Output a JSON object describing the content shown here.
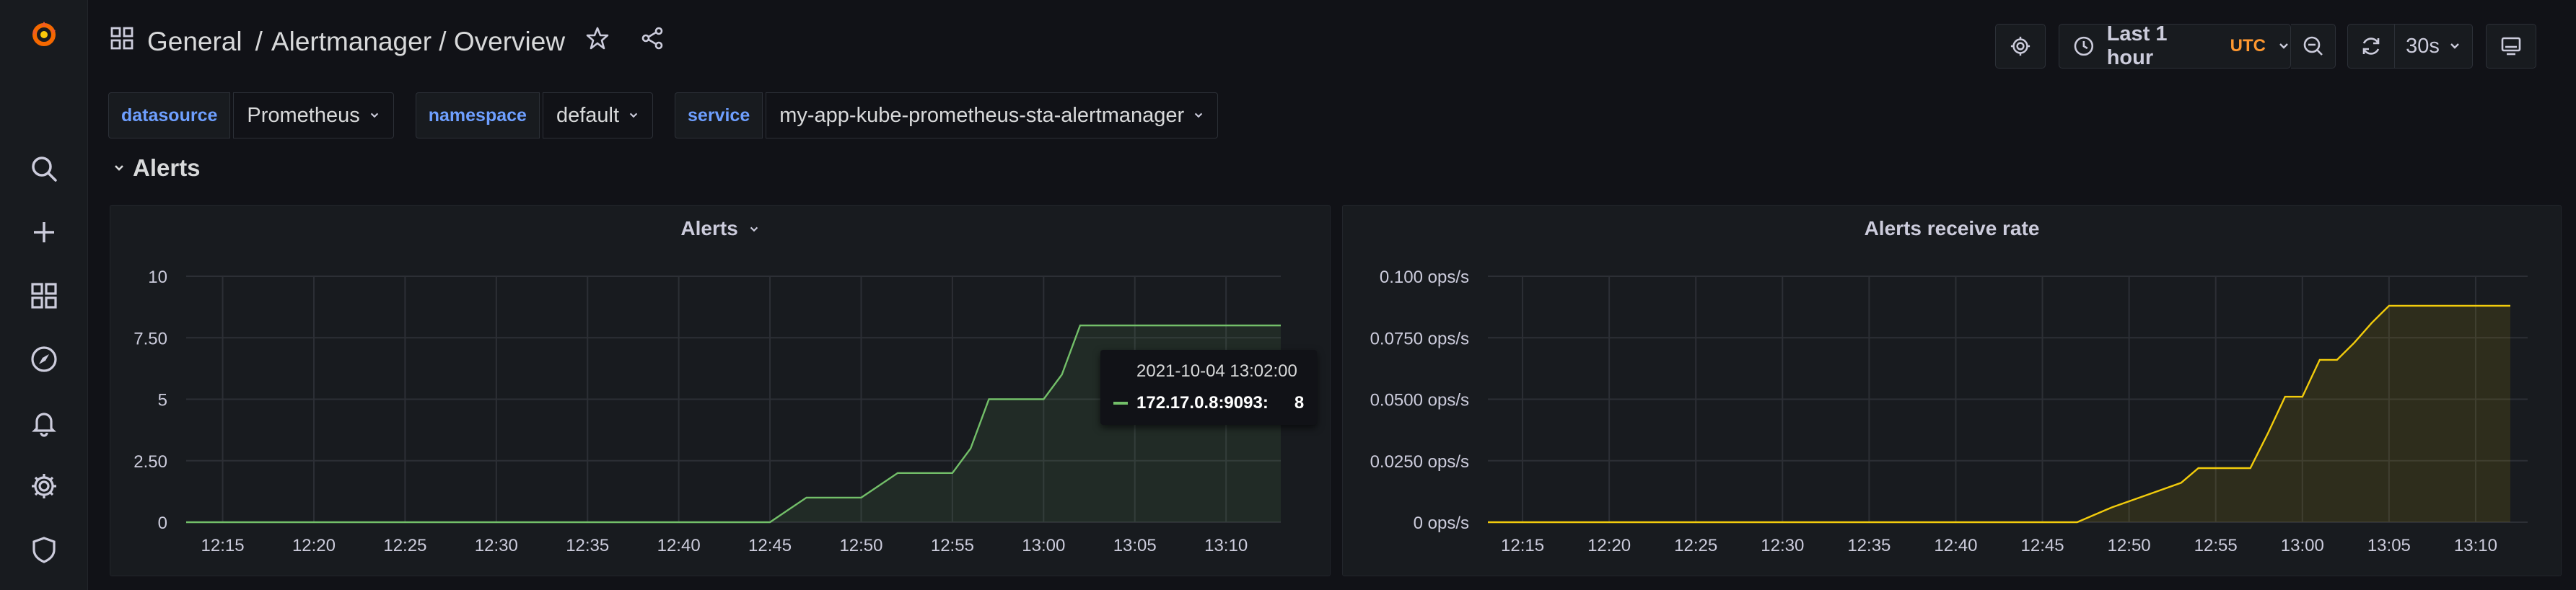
{
  "breadcrumb": {
    "folder": "General",
    "sep": "/",
    "path": "Alertmanager / Overview"
  },
  "toolbar": {
    "time_range": "Last 1 hour",
    "timezone": "UTC",
    "refresh": "30s"
  },
  "variables": [
    {
      "label": "datasource",
      "value": "Prometheus"
    },
    {
      "label": "namespace",
      "value": "default"
    },
    {
      "label": "service",
      "value": "my-app-kube-prometheus-sta-alertmanager"
    }
  ],
  "row": {
    "title": "Alerts"
  },
  "colors": {
    "alerts_series": "#73bf69",
    "rate_series": "#f2cc0c",
    "bg": "#111217",
    "panel": "#181b1f"
  },
  "icons": {
    "sidebar": [
      "grafana-logo-icon",
      "search-icon",
      "plus-icon",
      "dashboards-icon",
      "explore-icon",
      "alerting-bell-icon",
      "gear-icon",
      "shield-icon"
    ],
    "toolbar": [
      "gear-icon",
      "clock-icon",
      "zoom-out-icon",
      "refresh-icon",
      "tv-mode-icon"
    ]
  },
  "panels": [
    {
      "title": "Alerts",
      "has_menu": true,
      "tooltip": {
        "time": "2021-10-04 13:02:00",
        "series": "172.17.0.8:9093:",
        "value": "8"
      }
    },
    {
      "title": "Alerts receive rate",
      "has_menu": false
    }
  ],
  "chart_data": [
    {
      "type": "area",
      "title": "Alerts",
      "x_ticks": [
        "12:15",
        "12:20",
        "12:25",
        "12:30",
        "12:35",
        "12:40",
        "12:45",
        "12:50",
        "12:55",
        "13:00",
        "13:05",
        "13:10"
      ],
      "y_ticks": [
        "0",
        "2.50",
        "5",
        "7.50",
        "10"
      ],
      "ylim": [
        0,
        10
      ],
      "xlim": [
        "12:13",
        "13:13"
      ],
      "grid": true,
      "series": [
        {
          "name": "172.17.0.8:9093",
          "x": [
            "12:13",
            "12:45",
            "12:46",
            "12:47",
            "12:48",
            "12:49",
            "12:50",
            "12:51",
            "12:52",
            "12:53",
            "12:54",
            "12:55",
            "12:56",
            "12:57",
            "12:58",
            "12:59",
            "13:00",
            "13:01",
            "13:02",
            "13:03",
            "13:13"
          ],
          "y": [
            0,
            0,
            0.5,
            1,
            1,
            1,
            1,
            1.5,
            2,
            2,
            2,
            2,
            3,
            5,
            5,
            5,
            5,
            6,
            8,
            8,
            8
          ]
        }
      ]
    },
    {
      "type": "area",
      "title": "Alerts receive rate",
      "x_ticks": [
        "12:15",
        "12:20",
        "12:25",
        "12:30",
        "12:35",
        "12:40",
        "12:45",
        "12:50",
        "12:55",
        "13:00",
        "13:05",
        "13:10"
      ],
      "y_ticks": [
        "0 ops/s",
        "0.0250 ops/s",
        "0.0500 ops/s",
        "0.0750 ops/s",
        "0.100 ops/s"
      ],
      "ylim": [
        0,
        0.1
      ],
      "xlim": [
        "12:13",
        "13:13"
      ],
      "grid": true,
      "series": [
        {
          "name": "",
          "x": [
            "12:13",
            "12:47",
            "12:49",
            "12:51",
            "12:53",
            "12:54",
            "12:56",
            "12:57",
            "12:58",
            "12:59",
            "13:00",
            "13:01",
            "13:02",
            "13:03",
            "13:04",
            "13:05",
            "13:12"
          ],
          "y": [
            0,
            0,
            0.006,
            0.011,
            0.016,
            0.022,
            0.022,
            0.022,
            0.036,
            0.051,
            0.051,
            0.066,
            0.066,
            0.073,
            0.081,
            0.088,
            0.088
          ]
        }
      ]
    }
  ]
}
